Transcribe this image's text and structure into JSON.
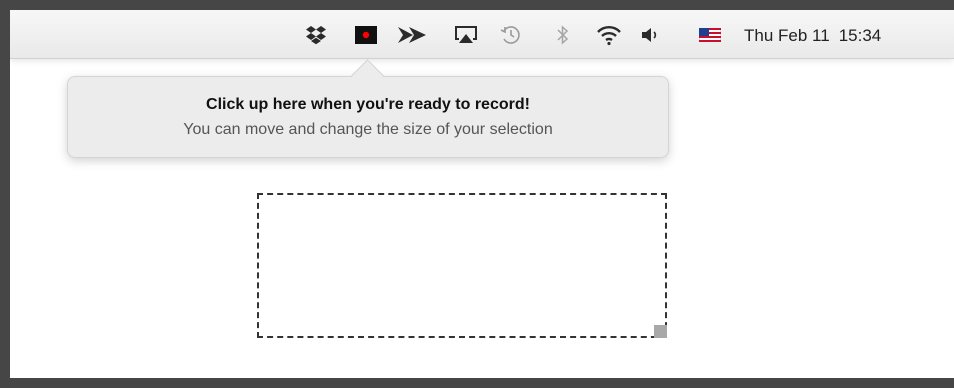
{
  "menubar": {
    "icons": [
      {
        "name": "dropbox-icon"
      },
      {
        "name": "record-icon",
        "color": "#ff0000"
      },
      {
        "name": "fast-forward-icon"
      },
      {
        "name": "airplay-icon"
      },
      {
        "name": "time-machine-icon"
      },
      {
        "name": "bluetooth-icon"
      },
      {
        "name": "wifi-icon"
      },
      {
        "name": "volume-icon"
      },
      {
        "name": "us-flag-icon"
      }
    ],
    "clock": {
      "date": "Thu Feb 11",
      "time": "15:34"
    }
  },
  "popover": {
    "title": "Click up here when you're ready to record!",
    "subtitle": "You can move and change the size of your selection"
  },
  "selection": {
    "handle": "resize-handle"
  }
}
